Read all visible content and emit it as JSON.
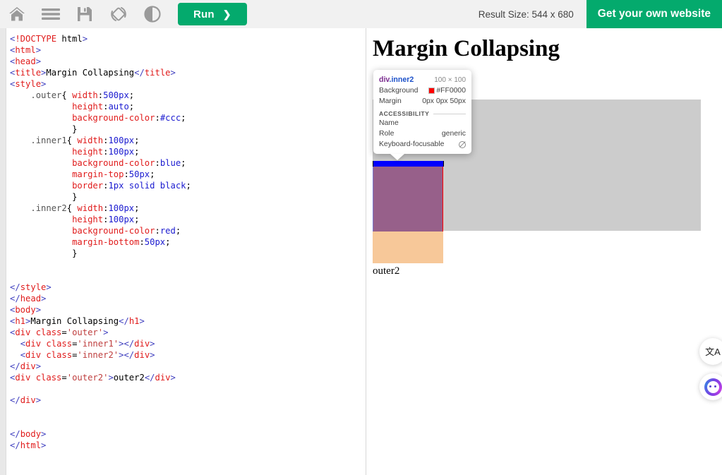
{
  "toolbar": {
    "icons": [
      {
        "name": "home-icon",
        "label": "Home"
      },
      {
        "name": "menu-icon",
        "label": "Menu"
      },
      {
        "name": "save-icon",
        "label": "Save"
      },
      {
        "name": "rotate-icon",
        "label": "Change Orientation"
      },
      {
        "name": "contrast-icon",
        "label": "Dark/Light Mode"
      }
    ],
    "run_label": "Run",
    "run_chevron": "❯",
    "result_size": "Result Size: 544 x 680",
    "get_website_label": "Get your own website"
  },
  "editor": {
    "code_lines": [
      "<!DOCTYPE html>",
      "<html>",
      "<head>",
      "<title>Margin Collapsing</title>",
      "<style>",
      "    .outer{ width:500px;",
      "            height:auto;",
      "            background-color:#ccc;",
      "            }",
      "    .inner1{ width:100px;",
      "            height:100px;",
      "            background-color:blue;",
      "            margin-top:50px;",
      "            border:1px solid black;",
      "            }",
      "    .inner2{ width:100px;",
      "            height:100px;",
      "            background-color:red;",
      "            margin-bottom:50px;",
      "            }",
      "",
      "",
      "</style>",
      "</head>",
      "<body>",
      "<h1>Margin Collapsing</h1>",
      "<div class='outer'>",
      "  <div class='inner1'></div>",
      "  <div class='inner2'></div>",
      "</div>",
      "<div class='outer2'>outer2</div>",
      "",
      "</div>",
      "",
      "",
      "</body>",
      "</html>"
    ]
  },
  "preview": {
    "heading": "Margin Collapsing",
    "outer2_label": "outer2",
    "colors": {
      "outer_background": "#cccccc",
      "inner1_background": "#0000ff",
      "inner2_background": "#ff0000",
      "devtools_content_highlight": "#97608a",
      "devtools_margin_highlight": "#f7c899"
    }
  },
  "inspector": {
    "selector_tag": "div",
    "selector_class": ".inner2",
    "dimensions": "100 × 100",
    "background_label": "Background",
    "background_value": "#FF0000",
    "background_swatch": "#FF0000",
    "margin_label": "Margin",
    "margin_value": "0px 0px 50px",
    "accessibility_header": "ACCESSIBILITY",
    "name_label": "Name",
    "name_value": "",
    "role_label": "Role",
    "role_value": "generic",
    "keyboard_label": "Keyboard-focusable",
    "keyboard_value_icon": "not-allowed-icon"
  },
  "widgets": {
    "translate": {
      "name": "translate-icon",
      "glyph": "文A"
    },
    "chat": {
      "name": "chat-assistant-orb-icon"
    }
  }
}
